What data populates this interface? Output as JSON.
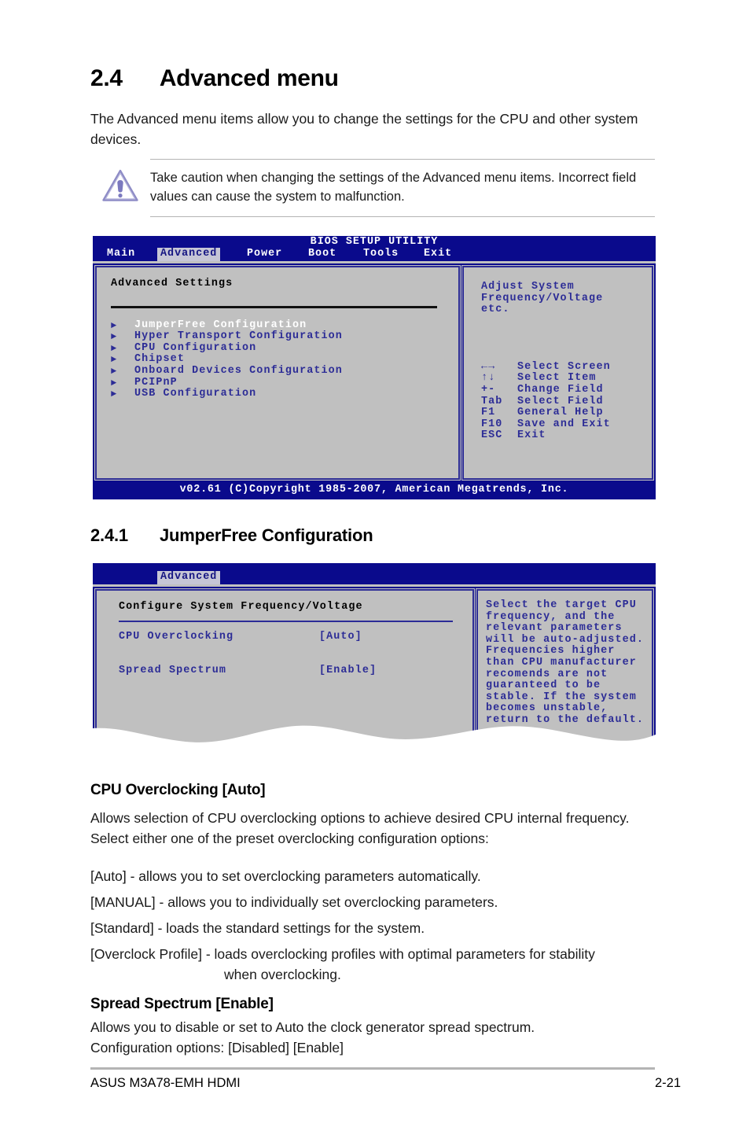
{
  "section": {
    "number": "2.4",
    "title": "Advanced menu",
    "intro": "The Advanced menu items allow you to change the settings for the CPU and other system devices."
  },
  "caution": {
    "icon": "warning-triangle-icon",
    "text": "Take caution when changing the settings of the Advanced menu items. Incorrect field values can cause the system to malfunction."
  },
  "bios_main": {
    "title": "BIOS SETUP UTILITY",
    "tabs": [
      {
        "label": "Main",
        "active": false
      },
      {
        "label": "Advanced",
        "active": true
      },
      {
        "label": "Power",
        "active": false
      },
      {
        "label": "Boot",
        "active": false
      },
      {
        "label": "Tools",
        "active": false
      },
      {
        "label": "Exit",
        "active": false
      }
    ],
    "pane_title": "Advanced Settings",
    "menu_items": [
      {
        "label": "JumperFree Configuration",
        "selected": true
      },
      {
        "label": "Hyper Transport Configuration",
        "selected": false
      },
      {
        "label": "CPU Configuration",
        "selected": false
      },
      {
        "label": "Chipset",
        "selected": false
      },
      {
        "label": "Onboard Devices Configuration",
        "selected": false
      },
      {
        "label": "PCIPnP",
        "selected": false
      },
      {
        "label": "USB Configuration",
        "selected": false
      }
    ],
    "help_lines": [
      "Adjust System",
      "Frequency/Voltage",
      "etc."
    ],
    "key_legend": [
      {
        "key": "←→",
        "desc": "Select Screen"
      },
      {
        "key": "↑↓",
        "desc": "Select Item"
      },
      {
        "key": "+-",
        "desc": "Change Field"
      },
      {
        "key": "Tab",
        "desc": "Select Field"
      },
      {
        "key": "F1",
        "desc": "General Help"
      },
      {
        "key": "F10",
        "desc": "Save and Exit"
      },
      {
        "key": "ESC",
        "desc": "Exit"
      }
    ],
    "footer": "v02.61 (C)Copyright 1985-2007, American Megatrends, Inc."
  },
  "subsection": {
    "number": "2.4.1",
    "title": "JumperFree Configuration"
  },
  "bios_jumperfree": {
    "tabs": [
      {
        "label": "Advanced",
        "active": true
      }
    ],
    "pane_title": "Configure System Frequency/Voltage",
    "fields": [
      {
        "label": "CPU Overclocking",
        "value": "[Auto]"
      },
      {
        "label": "Spread Spectrum",
        "value": "[Enable]"
      }
    ],
    "help_lines": [
      "Select the target CPU",
      "frequency, and the",
      "relevant parameters",
      "will be auto-adjusted.",
      "Frequencies higher",
      "than CPU manufacturer",
      "recomends are not",
      "guaranteed to be",
      "stable. If the system",
      "becomes unstable,",
      "return to the default."
    ]
  },
  "cpu_overclocking": {
    "heading": "CPU Overclocking [Auto]",
    "description": "Allows selection of CPU overclocking options to achieve desired CPU internal frequency. Select either one of the preset overclocking configuration options:",
    "option_auto": "[Auto] - allows you to set overclocking parameters automatically.",
    "option_manual": "[MANUAL] - allows you to individually set overclocking parameters.",
    "option_standard": "[Standard] - loads the standard settings for the system.",
    "option_profile_line1": "[Overclock Profile] - loads overclocking profiles with optimal parameters for stability",
    "option_profile_line2": "when overclocking."
  },
  "spread_spectrum": {
    "heading": "Spread Spectrum [Enable]",
    "description": "Allows you to disable or set to Auto the clock generator spread spectrum.",
    "config_options": "Configuration options: [Disabled] [Enable]"
  },
  "page_footer": {
    "left": "ASUS M3A78-EMH HDMI",
    "right": "2-21"
  },
  "colors": {
    "bios_blue": "#0a0a8c",
    "bios_gray": "#c0c0c0",
    "bios_text_blue": "#2c2c96",
    "tab_active_bg": "#c6c6d6",
    "warning_purple": "#7b79bf"
  }
}
